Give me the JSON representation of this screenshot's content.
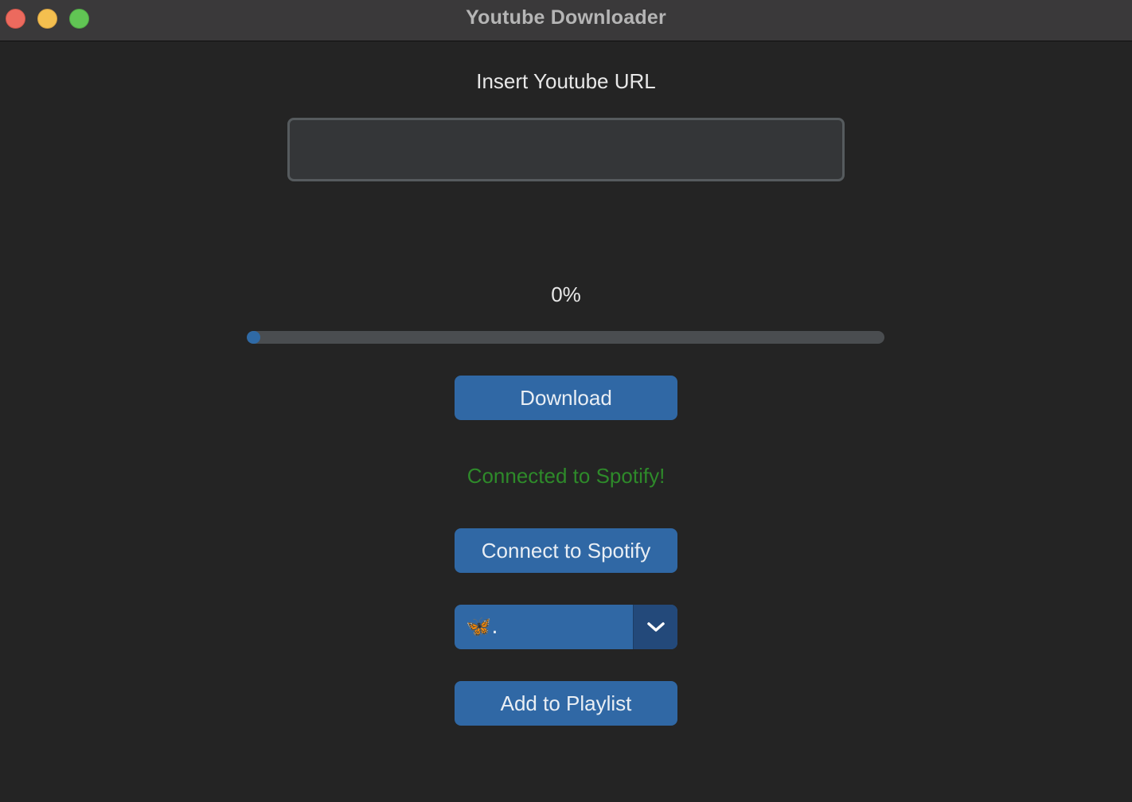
{
  "window": {
    "title": "Youtube Downloader"
  },
  "url_section": {
    "label": "Insert Youtube URL",
    "value": "",
    "placeholder": ""
  },
  "progress": {
    "percent_text": "0%",
    "value": 0.0
  },
  "buttons": {
    "download_label": "Download",
    "connect_label": "Connect to Spotify",
    "add_to_playlist_label": "Add to Playlist"
  },
  "status": {
    "text": "Connected to Spotify!",
    "color": "#2e8a2a"
  },
  "playlist_dropdown": {
    "selected": "🦋."
  },
  "colors": {
    "accent": "#3068a5",
    "accent_dark": "#23497a",
    "background": "#242424",
    "titlebar": "#3a393a"
  }
}
